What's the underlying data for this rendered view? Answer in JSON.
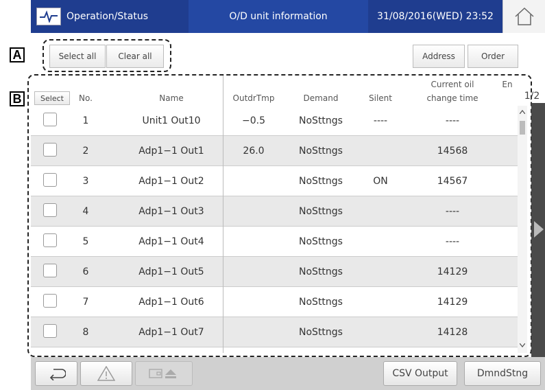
{
  "header": {
    "operation_status": "Operation/Status",
    "page_title": "O/D unit information",
    "datetime": "31/08/2016(WED) 23:52"
  },
  "toolbar": {
    "select_all": "Select all",
    "clear_all": "Clear all",
    "address": "Address",
    "order": "Order"
  },
  "callouts": {
    "a": "A",
    "b": "B"
  },
  "table": {
    "headers": {
      "select": "Select",
      "no": "No.",
      "name": "Name",
      "outdr_tmp": "OutdrTmp",
      "demand": "Demand",
      "silent": "Silent",
      "oil_time_line1": "Current oil",
      "oil_time_line2": "change time",
      "en": "En"
    },
    "page_indicator": "1/2",
    "rows": [
      {
        "no": "1",
        "name": "Unit1 Out10",
        "outdr_tmp": "−0.5",
        "demand": "NoSttngs",
        "silent": "----",
        "oil": "----"
      },
      {
        "no": "2",
        "name": "Adp1−1 Out1",
        "outdr_tmp": "26.0",
        "demand": "NoSttngs",
        "silent": "",
        "oil": "14568"
      },
      {
        "no": "3",
        "name": "Adp1−1 Out2",
        "outdr_tmp": "",
        "demand": "NoSttngs",
        "silent": "ON",
        "oil": "14567"
      },
      {
        "no": "4",
        "name": "Adp1−1 Out3",
        "outdr_tmp": "",
        "demand": "NoSttngs",
        "silent": "",
        "oil": "----"
      },
      {
        "no": "5",
        "name": "Adp1−1 Out4",
        "outdr_tmp": "",
        "demand": "NoSttngs",
        "silent": "",
        "oil": "----"
      },
      {
        "no": "6",
        "name": "Adp1−1 Out5",
        "outdr_tmp": "",
        "demand": "NoSttngs",
        "silent": "",
        "oil": "14129"
      },
      {
        "no": "7",
        "name": "Adp1−1 Out6",
        "outdr_tmp": "",
        "demand": "NoSttngs",
        "silent": "",
        "oil": "14129"
      },
      {
        "no": "8",
        "name": "Adp1−1 Out7",
        "outdr_tmp": "",
        "demand": "NoSttngs",
        "silent": "",
        "oil": "14128"
      }
    ]
  },
  "footer": {
    "csv_output": "CSV Output",
    "dmnd_stng": "DmndStng",
    "back_icon": "back-arrow-icon",
    "warning_icon": "warning-icon",
    "eject_icon": "eject-icon"
  },
  "colors": {
    "header_blue": "#1f3d8f",
    "row_alt": "#e9e9e9",
    "footer": "#d0d0d0"
  }
}
